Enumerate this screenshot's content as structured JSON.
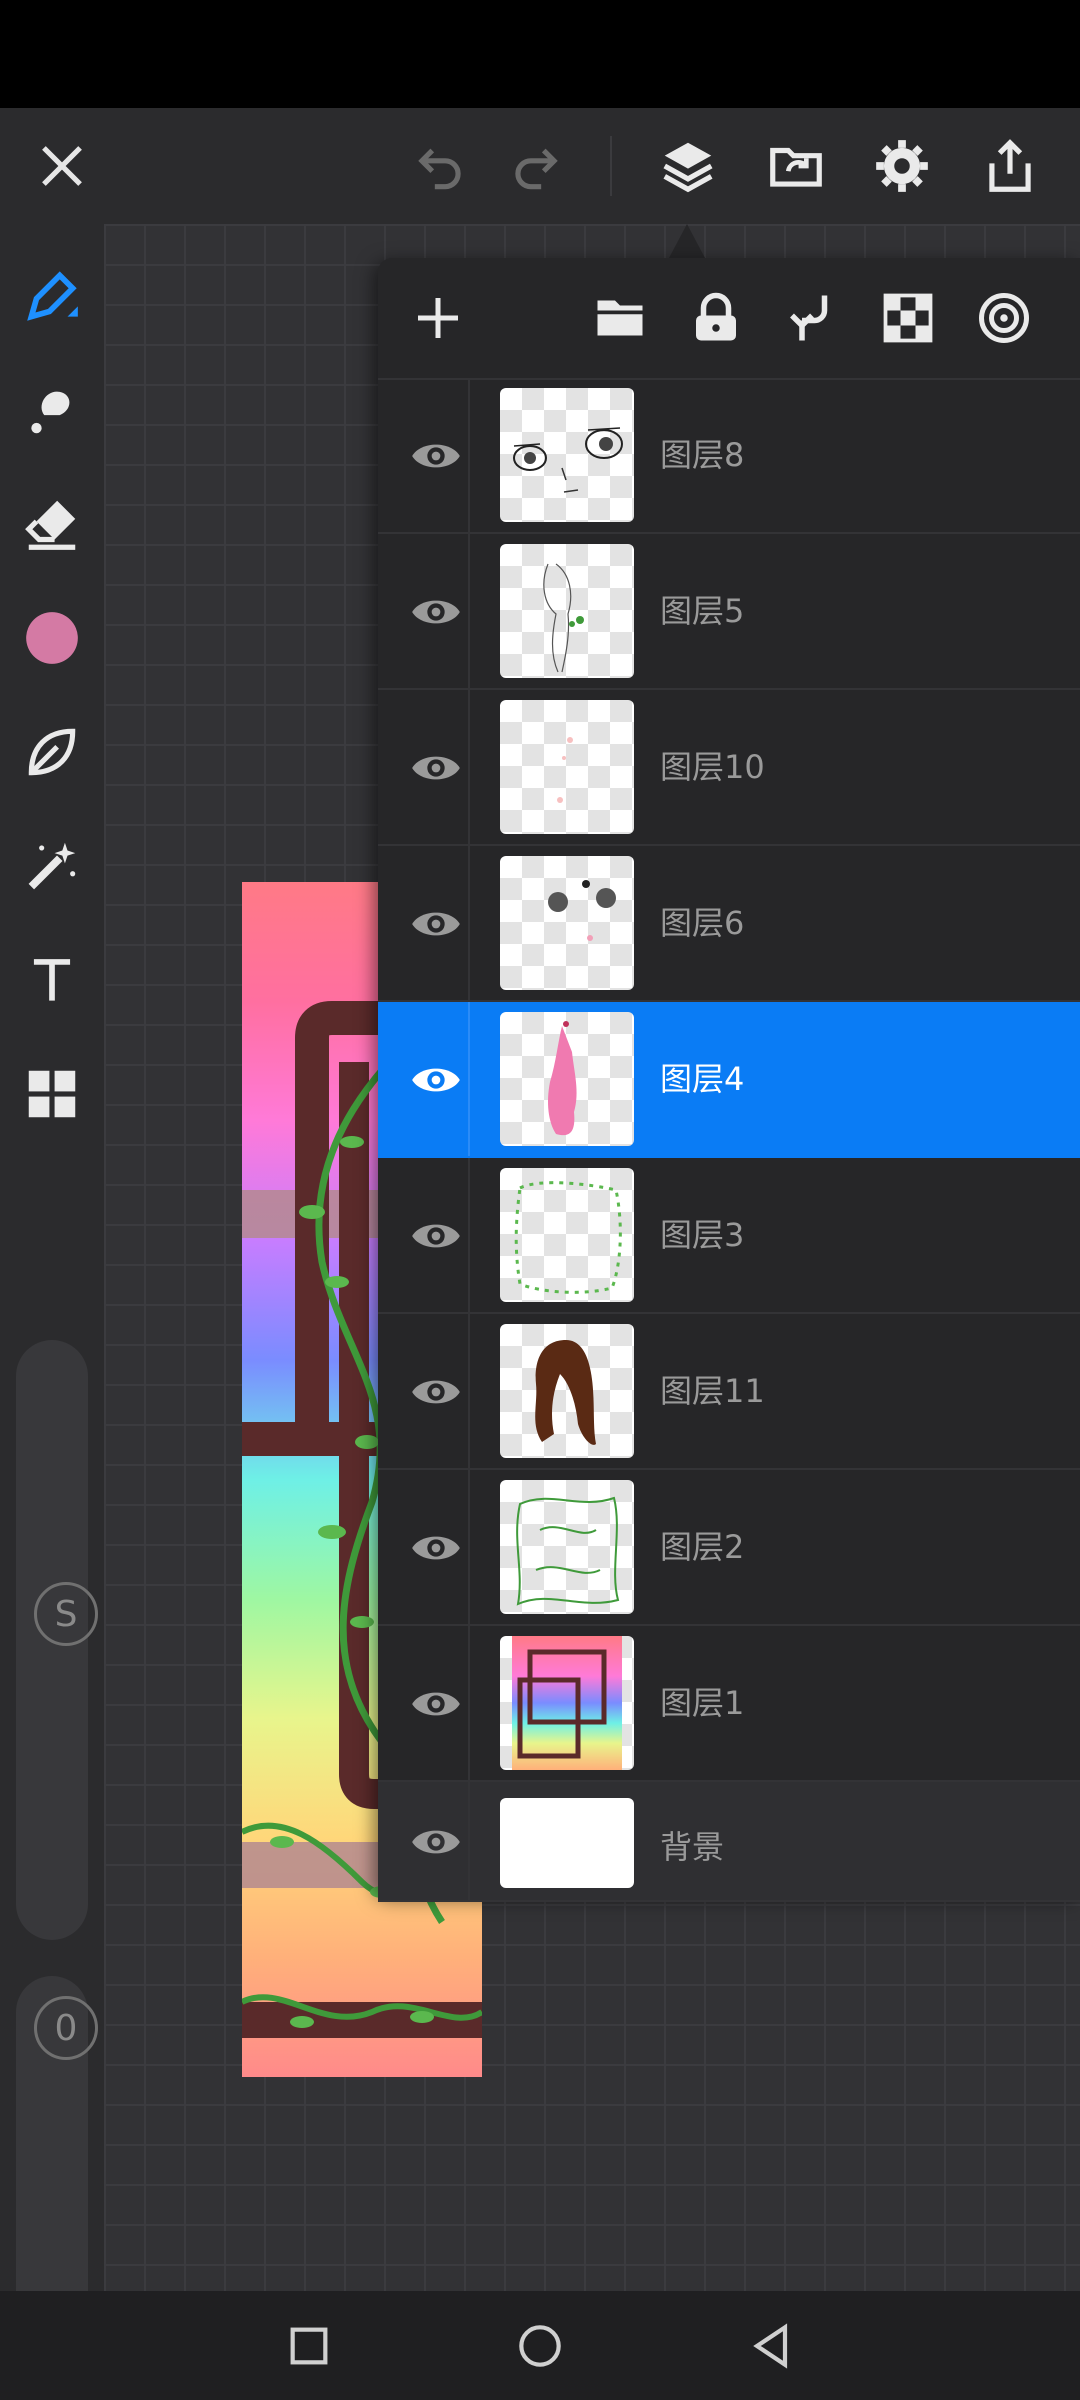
{
  "toolbar": {
    "icons": [
      "close-icon",
      "undo-icon",
      "redo-icon",
      "layers-icon",
      "import-icon",
      "settings-icon",
      "export-icon"
    ]
  },
  "sidebar": {
    "tools": [
      "brush-icon",
      "smudge-icon",
      "eraser-icon",
      "color-swatch",
      "shape-icon",
      "magic-wand-icon",
      "text-icon",
      "grid-icon"
    ],
    "brush_color": "#d47aa4",
    "size_badge": "S",
    "opacity_badge": "0"
  },
  "layers_panel": {
    "toolbar_icons": [
      "add-icon",
      "folder-icon",
      "lock-icon",
      "merge-down-icon",
      "transparency-icon",
      "target-icon"
    ],
    "layers": [
      {
        "name": "图层8",
        "visible": true,
        "selected": false
      },
      {
        "name": "图层5",
        "visible": true,
        "selected": false
      },
      {
        "name": "图层10",
        "visible": true,
        "selected": false
      },
      {
        "name": "图层6",
        "visible": true,
        "selected": false
      },
      {
        "name": "图层4",
        "visible": true,
        "selected": true
      },
      {
        "name": "图层3",
        "visible": true,
        "selected": false
      },
      {
        "name": "图层11",
        "visible": true,
        "selected": false
      },
      {
        "name": "图层2",
        "visible": true,
        "selected": false
      },
      {
        "name": "图层1",
        "visible": true,
        "selected": false
      },
      {
        "name": "背景",
        "visible": true,
        "selected": false
      }
    ]
  },
  "colors": {
    "selection": "#0a7cf5",
    "active_tool": "#1e90ff",
    "frame_brown": "#5a2a2a",
    "vine_green": "#3f9a3a"
  },
  "navbar": {
    "icons": [
      "recent-apps-icon",
      "home-icon",
      "back-icon"
    ]
  }
}
